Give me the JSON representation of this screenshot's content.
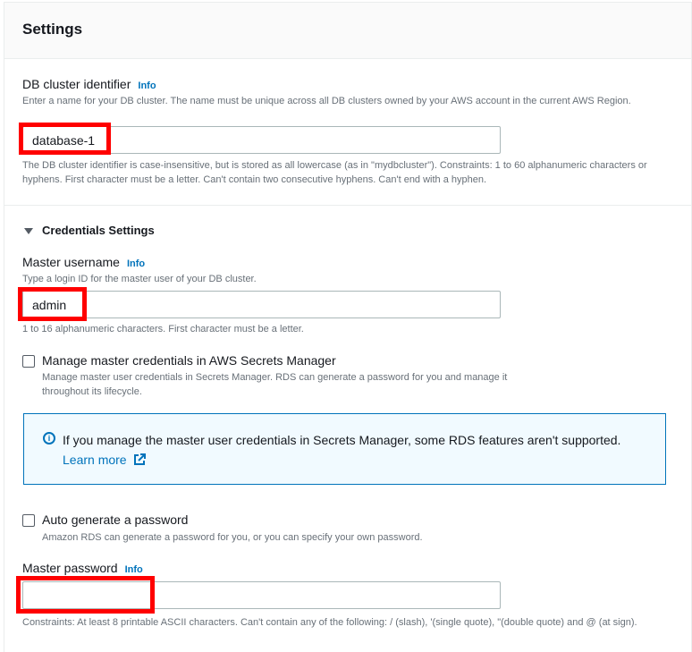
{
  "header": {
    "title": "Settings"
  },
  "db_identifier": {
    "label": "DB cluster identifier",
    "info": "Info",
    "description": "Enter a name for your DB cluster. The name must be unique across all DB clusters owned by your AWS account in the current AWS Region.",
    "value": "database-1",
    "constraint": "The DB cluster identifier is case-insensitive, but is stored as all lowercase (as in \"mydbcluster\"). Constraints: 1 to 60 alphanumeric characters or hyphens. First character must be a letter. Can't contain two consecutive hyphens. Can't end with a hyphen."
  },
  "credentials": {
    "title": "Credentials Settings",
    "username": {
      "label": "Master username",
      "info": "Info",
      "description": "Type a login ID for the master user of your DB cluster.",
      "value": "admin",
      "constraint": "1 to 16 alphanumeric characters. First character must be a letter."
    },
    "secrets_manager": {
      "label": "Manage master credentials in AWS Secrets Manager",
      "description": "Manage master user credentials in Secrets Manager. RDS can generate a password for you and manage it throughout its lifecycle.",
      "checked": false
    },
    "alert": {
      "text": "If you manage the master user credentials in Secrets Manager, some RDS features aren't supported.",
      "link": "Learn more"
    },
    "auto_generate": {
      "label": "Auto generate a password",
      "description": "Amazon RDS can generate a password for you, or you can specify your own password.",
      "checked": false
    },
    "password": {
      "label": "Master password",
      "info": "Info",
      "value": "",
      "constraint": "Constraints: At least 8 printable ASCII characters. Can't contain any of the following: / (slash), '(single quote), \"(double quote) and @ (at sign)."
    }
  },
  "colors": {
    "link": "#0073bb",
    "highlight": "#ff0000"
  }
}
